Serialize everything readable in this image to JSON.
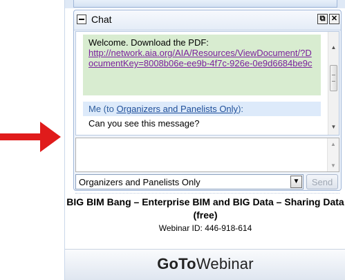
{
  "chat": {
    "title": "Chat",
    "popout_glyph": "⧉",
    "close_glyph": "✕",
    "welcome": {
      "text": "Welcome. Download the PDF:",
      "link": "http://network.aia.org/AIA/Resources/ViewDocument/?DocumentKey=8008b06e-ee9b-4f7c-926e-0e9d6684be9c"
    },
    "me_message": {
      "prefix": "Me (to ",
      "recipient_link": "Organizers and Panelists Only",
      "suffix": "):",
      "text": "Can you see this message?"
    },
    "compose": {
      "value": ""
    },
    "recipient": {
      "selected": "Organizers and Panelists Only"
    },
    "send_label": "Send"
  },
  "webinar": {
    "title": "BIG BIM Bang – Enterprise BIM and BIG Data – Sharing Data (free)",
    "id_text": "Webinar ID: 446-918-614"
  },
  "brand": {
    "part1": "GoTo",
    "part2": "Webinar"
  },
  "colors": {
    "arrow": "#e01b1b",
    "welcome_bg": "#d8ecd0",
    "link_visited": "#7a1f9c",
    "me_bg": "#ddeafa"
  },
  "icons": [
    "collapse-icon",
    "popout-icon",
    "close-icon",
    "scroll-up-icon",
    "scroll-down-icon",
    "dropdown-arrow-icon",
    "red-arrow-icon"
  ]
}
